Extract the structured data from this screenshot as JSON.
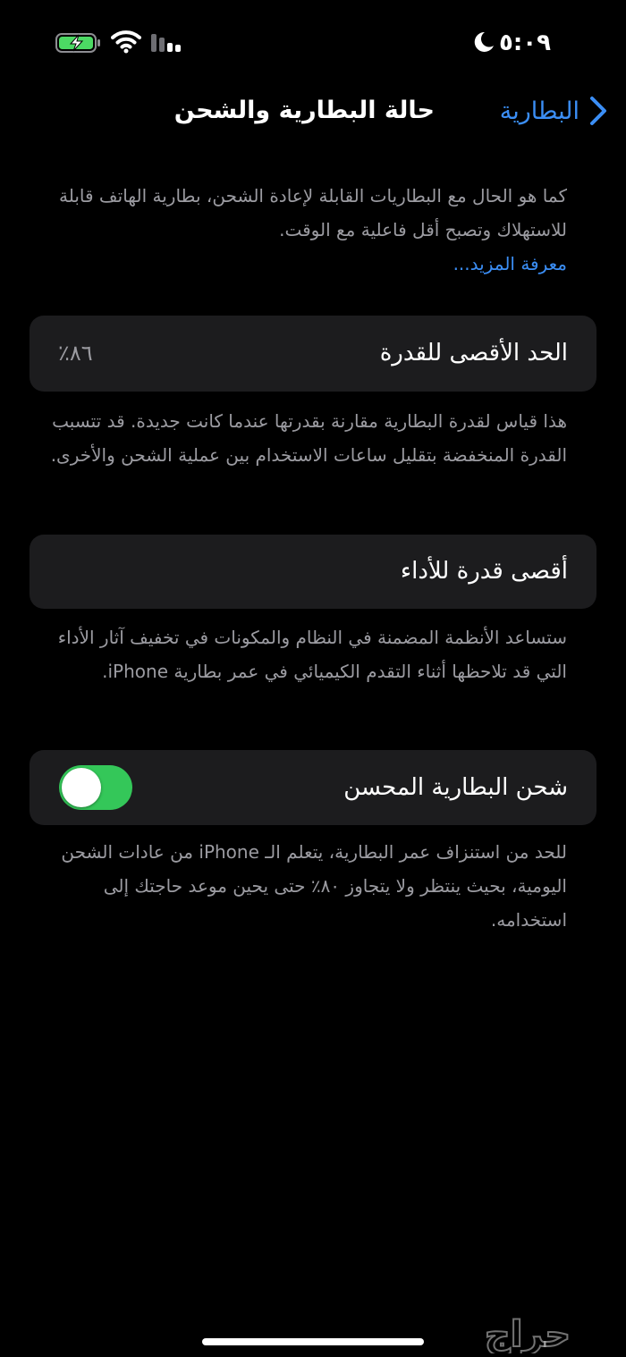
{
  "status_bar": {
    "time": "٥:٠٩",
    "icons": [
      "battery-charging-icon",
      "wifi-icon",
      "cellular-signal-icon",
      "moon-icon"
    ]
  },
  "nav": {
    "back_label": "البطارية",
    "title": "حالة البطارية والشحن"
  },
  "intro": {
    "text": "كما هو الحال مع البطاريات القابلة لإعادة الشحن، بطارية الهاتف قابلة للاستهلاك وتصبح أقل فاعلية مع الوقت.",
    "learn_more": "معرفة المزيد..."
  },
  "maximum_capacity": {
    "label": "الحد الأقصى للقدرة",
    "value": "٨٦٪",
    "value_percent": 86,
    "note": "هذا قياس لقدرة البطارية مقارنة بقدرتها عندما كانت جديدة. قد تتسبب القدرة المنخفضة بتقليل ساعات الاستخدام بين عملية الشحن والأخرى."
  },
  "peak_performance": {
    "label": "أقصى قدرة للأداء",
    "note": "ستساعد الأنظمة المضمنة في النظام والمكونات في تخفيف آثار الأداء التي قد تلاحظها أثناء التقدم الكيميائي في عمر بطارية iPhone."
  },
  "optimized_charging": {
    "label": "شحن البطارية المحسن",
    "enabled": true,
    "note": "للحد من استنزاف عمر البطارية، يتعلم الـ iPhone من عادات الشحن اليومية، بحيث ينتظر ولا يتجاوز ٨٠٪ حتى يحين موعد حاجتك إلى استخدامه."
  },
  "watermark": "حراج",
  "colors": {
    "background": "#000000",
    "card": "#1c1c1e",
    "accent": "#3b8ef5",
    "toggle_on": "#34c759",
    "battery_charge": "#4cd964",
    "secondary_text": "#9b9ba1"
  }
}
